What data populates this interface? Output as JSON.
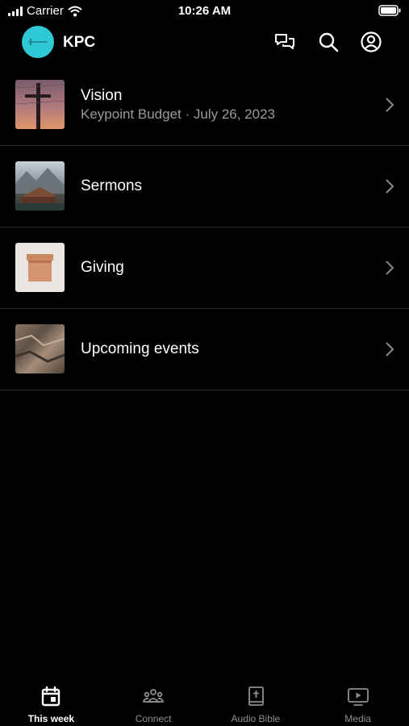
{
  "status_bar": {
    "carrier": "Carrier",
    "time": "10:26 AM"
  },
  "header": {
    "title": "KPC",
    "accent": "#2fc9d6"
  },
  "items": [
    {
      "title": "Vision",
      "subtitle": "Keypoint Budget · July 26, 2023"
    },
    {
      "title": "Sermons"
    },
    {
      "title": "Giving"
    },
    {
      "title": "Upcoming events"
    }
  ],
  "tabs": [
    {
      "label": "This week",
      "icon": "calendar-icon"
    },
    {
      "label": "Connect",
      "icon": "people-icon"
    },
    {
      "label": "Audio Bible",
      "icon": "bible-icon"
    },
    {
      "label": "Media",
      "icon": "play-screen-icon"
    }
  ]
}
